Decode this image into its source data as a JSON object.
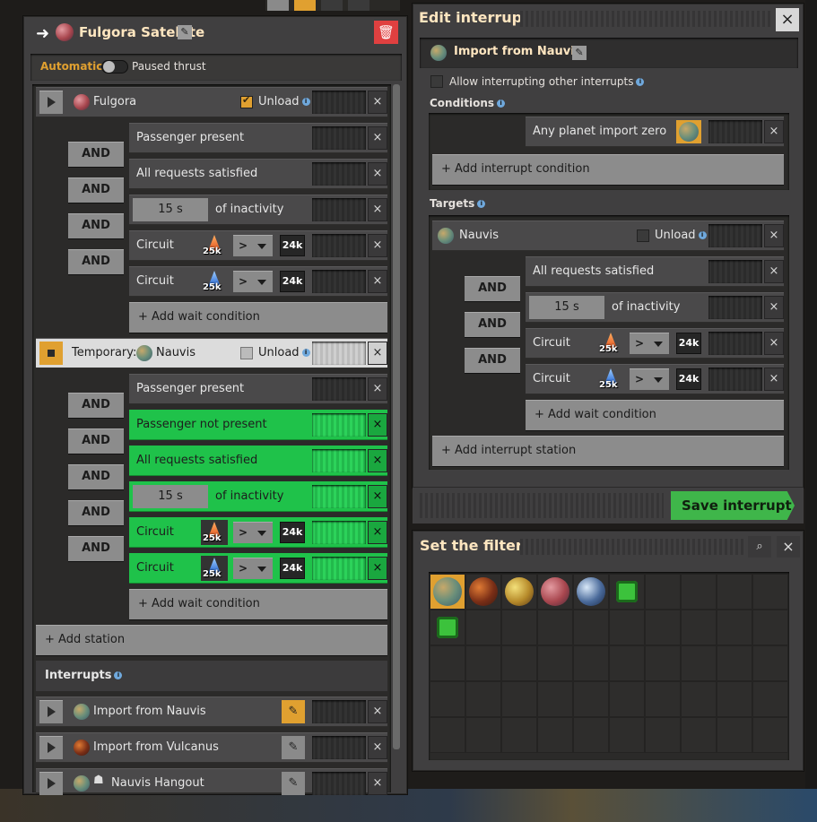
{
  "train": {
    "title": "Fulgora Satellite",
    "automatic": "Automatic",
    "paused_thrust": "Paused thrust",
    "stations": [
      {
        "name": "Fulgora",
        "unload": "Unload",
        "conditions": [
          {
            "label": "Passenger present"
          },
          {
            "label": "All requests satisfied"
          },
          {
            "time": "15 s",
            "label": "of inactivity"
          },
          {
            "label": "Circuit",
            "count": "25k",
            "op": ">",
            "value": "24k"
          },
          {
            "label": "Circuit",
            "count": "25k",
            "op": ">",
            "value": "24k"
          }
        ],
        "and": [
          "AND",
          "AND",
          "AND",
          "AND"
        ]
      },
      {
        "prefix": "Temporary:",
        "name": "Nauvis",
        "unload": "Unload",
        "conditions": [
          {
            "label": "Passenger present"
          },
          {
            "label": "Passenger not present"
          },
          {
            "label": "All requests satisfied"
          },
          {
            "time": "15 s",
            "label": "of inactivity"
          },
          {
            "label": "Circuit",
            "count": "25k",
            "op": ">",
            "value": "24k"
          },
          {
            "label": "Circuit",
            "count": "25k",
            "op": ">",
            "value": "24k"
          }
        ],
        "and": [
          "AND",
          "AND",
          "AND",
          "AND",
          "AND"
        ]
      }
    ],
    "add_wait": "+ Add wait condition",
    "add_station": "+ Add station",
    "interrupts_label": "Interrupts",
    "interrupts": [
      "Import from Nauvis",
      "Import from Vulcanus",
      "Nauvis Hangout"
    ]
  },
  "edit_interrupt": {
    "title": "Edit interrupt",
    "name": "Import from Nauvis",
    "allow": "Allow interrupting other interrupts",
    "conditions_label": "Conditions",
    "condition": "Any planet import zero",
    "add_interrupt_condition": "+ Add interrupt condition",
    "targets_label": "Targets",
    "target_name": "Nauvis",
    "target_unload": "Unload",
    "target_conditions": [
      {
        "label": "All requests satisfied"
      },
      {
        "time": "15 s",
        "label": "of inactivity"
      },
      {
        "label": "Circuit",
        "count": "25k",
        "op": ">",
        "value": "24k"
      },
      {
        "label": "Circuit",
        "count": "25k",
        "op": ">",
        "value": "24k"
      }
    ],
    "and": [
      "AND",
      "AND",
      "AND"
    ],
    "add_wait": "+ Add wait condition",
    "add_station": "+ Add interrupt station",
    "save": "Save interrupt"
  },
  "filter": {
    "title": "Set the filter",
    "icons": [
      "nauvis-icon",
      "vulcanus-icon",
      "gleba-icon",
      "fulgora-icon",
      "aquilo-icon",
      "space-platform-chip-icon"
    ]
  },
  "colors": {
    "green": "#1fc24a",
    "accent": "#e0a030",
    "delete": "#e04040"
  }
}
